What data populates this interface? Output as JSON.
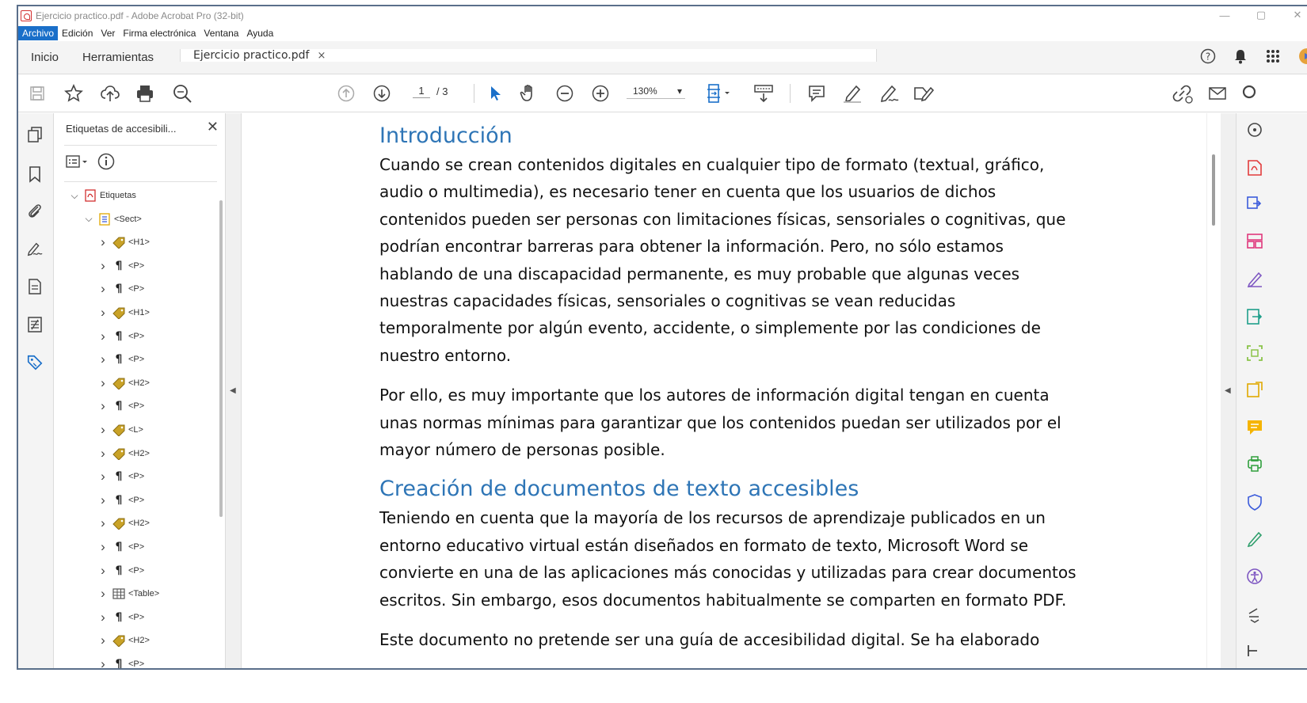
{
  "window": {
    "title": "Ejercicio practico.pdf - Adobe Acrobat Pro (32-bit)",
    "controls": [
      "—",
      "▢",
      "✕"
    ]
  },
  "menu": {
    "items": [
      "Archivo",
      "Edición",
      "Ver",
      "Firma electrónica",
      "Ventana",
      "Ayuda"
    ]
  },
  "tabs": {
    "home": "Inicio",
    "tools": "Herramientas",
    "document": "Ejercicio practico.pdf",
    "close": "×"
  },
  "toolbar": {
    "current_page": "1",
    "total_pages": "/ 3",
    "zoom": "130%",
    "zoom_arrow": "▾"
  },
  "tags_panel": {
    "title": "Etiquetas de accesibili...",
    "close": "✕",
    "tree": [
      {
        "label": "Etiquetas",
        "level": 0,
        "icon": "pdf-tags-root-icon",
        "expanded": true
      },
      {
        "label": "<Sect>",
        "level": 1,
        "icon": "section-tag-icon",
        "expanded": true
      },
      {
        "label": "<H1>",
        "level": 2,
        "icon": "tag-icon"
      },
      {
        "label": "<P>",
        "level": 2,
        "icon": "paragraph-icon"
      },
      {
        "label": "<P>",
        "level": 2,
        "icon": "paragraph-icon"
      },
      {
        "label": "<H1>",
        "level": 2,
        "icon": "tag-icon"
      },
      {
        "label": "<P>",
        "level": 2,
        "icon": "paragraph-icon"
      },
      {
        "label": "<P>",
        "level": 2,
        "icon": "paragraph-icon"
      },
      {
        "label": "<H2>",
        "level": 2,
        "icon": "tag-icon"
      },
      {
        "label": "<P>",
        "level": 2,
        "icon": "paragraph-icon"
      },
      {
        "label": "<L>",
        "level": 2,
        "icon": "tag-icon"
      },
      {
        "label": "<H2>",
        "level": 2,
        "icon": "tag-icon"
      },
      {
        "label": "<P>",
        "level": 2,
        "icon": "paragraph-icon"
      },
      {
        "label": "<P>",
        "level": 2,
        "icon": "paragraph-icon"
      },
      {
        "label": "<H2>",
        "level": 2,
        "icon": "tag-icon"
      },
      {
        "label": "<P>",
        "level": 2,
        "icon": "paragraph-icon"
      },
      {
        "label": "<P>",
        "level": 2,
        "icon": "paragraph-icon"
      },
      {
        "label": "<Table>",
        "level": 2,
        "icon": "table-icon"
      },
      {
        "label": "<P>",
        "level": 2,
        "icon": "paragraph-icon"
      },
      {
        "label": "<H2>",
        "level": 2,
        "icon": "tag-icon"
      },
      {
        "label": "<P>",
        "level": 2,
        "icon": "paragraph-icon"
      }
    ]
  },
  "document": {
    "heading1": "Introducción",
    "para1_lines": [
      "Cuando se crean contenidos digitales en cualquier tipo de formato (textual, gráfico,",
      "audio o multimedia), es necesario tener en cuenta que los usuarios de dichos",
      "contenidos pueden ser personas con limitaciones físicas, sensoriales o cognitivas, que",
      "podrían encontrar barreras para obtener la información. Pero, no sólo estamos",
      "hablando de una discapacidad permanente, es muy probable que algunas veces",
      "nuestras capacidades físicas, sensoriales o cognitivas se vean reducidas",
      "temporalmente por algún evento, accidente, o simplemente por las condiciones de",
      "nuestro entorno."
    ],
    "para2_lines": [
      "Por ello, es muy importante que los autores de información digital tengan en cuenta",
      "unas normas mínimas para garantizar que los contenidos puedan ser utilizados por el",
      "mayor número de personas posible."
    ],
    "heading2": "Creación de documentos de texto accesibles",
    "para3_lines": [
      "Teniendo en cuenta que la mayoría de los recursos de aprendizaje publicados en un",
      "entorno educativo virtual están diseñados en formato de texto, Microsoft Word se",
      "convierte en una de las aplicaciones más conocidas y utilizadas para crear documentos",
      "escritos. Sin embargo, esos documentos habitualmente se comparten en formato PDF."
    ],
    "para4_lines": [
      "Este documento no pretende ser una guía de accesibilidad digital. Se ha elaborado"
    ]
  },
  "colors": {
    "heading": "#2e75b6",
    "accent": "#1a6fc9",
    "tag_icon": "#c9a227"
  }
}
